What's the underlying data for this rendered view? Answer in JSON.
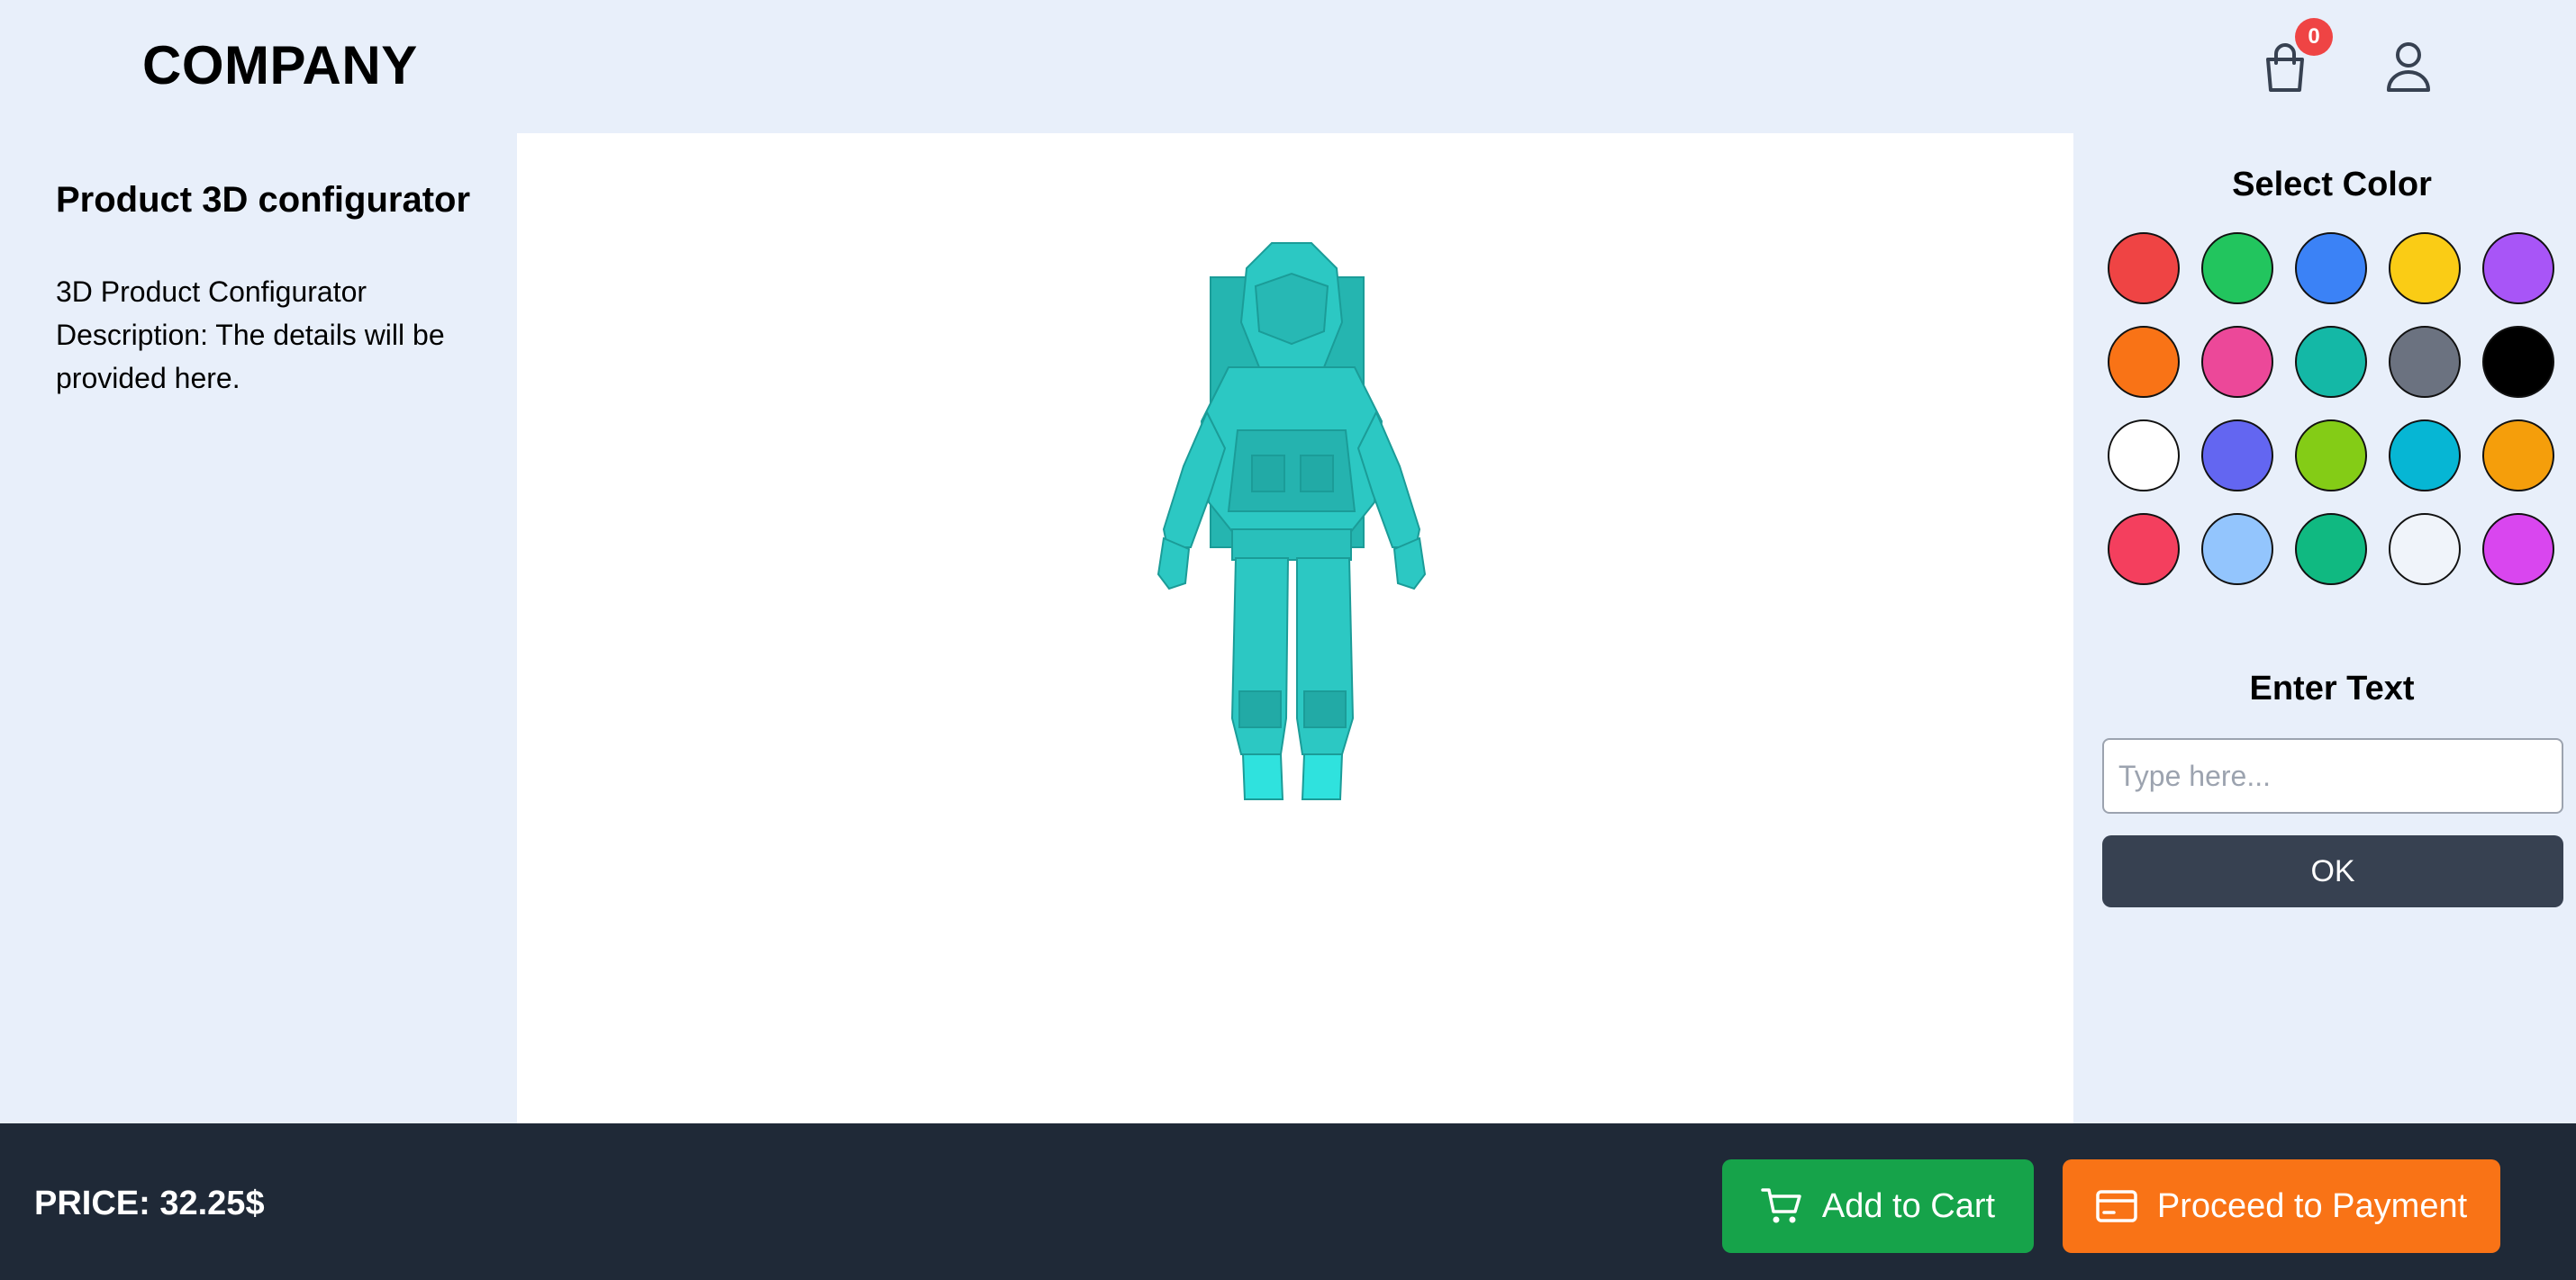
{
  "header": {
    "logo": "COMPANY",
    "cart_count": "0",
    "cart_icon": "shopping-bag-icon",
    "user_icon": "user-icon"
  },
  "product": {
    "title": "Product 3D configurator",
    "description": "3D Product Configurator Description: The details will be provided here."
  },
  "viewer": {
    "model": "astronaut",
    "model_color": "#2dd4bf"
  },
  "color_picker": {
    "title": "Select Color",
    "colors": [
      "#ef4444",
      "#22c55e",
      "#3b82f6",
      "#facc15",
      "#a855f7",
      "#f97316",
      "#ec4899",
      "#14b8a6",
      "#6b7280",
      "#000000",
      "#ffffff",
      "#6366f1",
      "#84cc16",
      "#06b6d4",
      "#f59e0b",
      "#f43f5e",
      "#93c5fd",
      "#10b981",
      "#f0f4fa",
      "#d946ef"
    ]
  },
  "text_entry": {
    "title": "Enter Text",
    "placeholder": "Type here...",
    "value": "",
    "button_label": "OK"
  },
  "footer": {
    "price": "PRICE: 32.25$",
    "add_to_cart_label": "Add to Cart",
    "proceed_label": "Proceed to Payment",
    "cart_icon": "cart-icon",
    "card_icon": "credit-card-icon",
    "add_to_cart_color": "#16a34a",
    "proceed_color": "#f97316"
  }
}
